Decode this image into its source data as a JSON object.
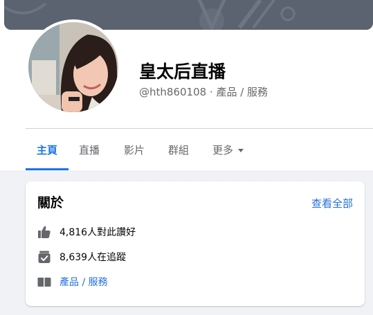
{
  "page": {
    "name": "皇太后直播",
    "handle_category": "@hth860108 · 產品 / 服務"
  },
  "tabs": [
    {
      "label": "主頁"
    },
    {
      "label": "直播"
    },
    {
      "label": "影片"
    },
    {
      "label": "群組"
    },
    {
      "label": "更多"
    }
  ],
  "about": {
    "title": "關於",
    "see_all": "查看全部",
    "likes": "4,816人對此讚好",
    "followers": "8,639人在追蹤",
    "category": "產品 / 服務"
  },
  "icons": {
    "likes": "thumbs-up-icon",
    "followers": "follow-check-icon",
    "category": "category-folder-icon",
    "more": "chevron-down-icon"
  },
  "colors": {
    "accent": "#1b74e4",
    "link": "#216fdb",
    "icon": "#65676b",
    "cover": "#5b6270"
  }
}
